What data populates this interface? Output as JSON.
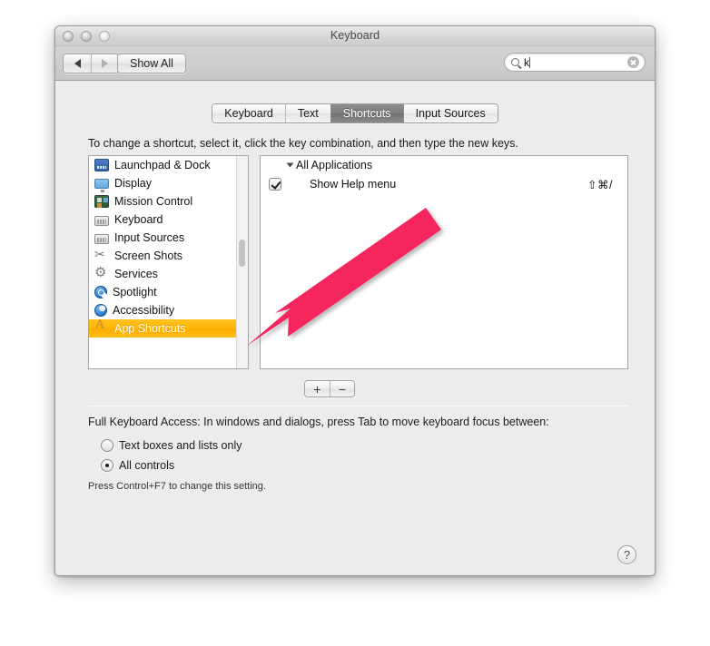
{
  "window": {
    "title": "Keyboard",
    "traffic_lights": [
      "close",
      "minimize",
      "zoom"
    ]
  },
  "toolbar": {
    "back_label": "Back",
    "forward_label": "Forward",
    "show_all_label": "Show All",
    "search": {
      "value": "k",
      "placeholder": "Search",
      "icon": "search-icon",
      "clear_icon": "clear-icon"
    }
  },
  "tabs": [
    {
      "label": "Keyboard",
      "selected": false
    },
    {
      "label": "Text",
      "selected": false
    },
    {
      "label": "Shortcuts",
      "selected": true
    },
    {
      "label": "Input Sources",
      "selected": false
    }
  ],
  "instruction": "To change a shortcut, select it, click the key combination, and then type the new keys.",
  "categories": [
    {
      "label": "Launchpad & Dock",
      "icon": "launchpad-dock-icon",
      "selected": false
    },
    {
      "label": "Display",
      "icon": "display-icon",
      "selected": false
    },
    {
      "label": "Mission Control",
      "icon": "mission-control-icon",
      "selected": false
    },
    {
      "label": "Keyboard",
      "icon": "keyboard-icon",
      "selected": false
    },
    {
      "label": "Input Sources",
      "icon": "input-sources-icon",
      "selected": false
    },
    {
      "label": "Screen Shots",
      "icon": "screen-shots-icon",
      "selected": false
    },
    {
      "label": "Services",
      "icon": "services-gear-icon",
      "selected": false
    },
    {
      "label": "Spotlight",
      "icon": "spotlight-icon",
      "selected": false
    },
    {
      "label": "Accessibility",
      "icon": "accessibility-icon",
      "selected": false
    },
    {
      "label": "App Shortcuts",
      "icon": "app-shortcuts-icon",
      "selected": true
    }
  ],
  "shortcuts": {
    "group_label": "All Applications",
    "items": [
      {
        "label": "Show Help menu",
        "keys": "⇧⌘/",
        "checked": true
      }
    ]
  },
  "list_buttons": {
    "add_label": "+",
    "remove_label": "−"
  },
  "full_keyboard_access": {
    "label": "Full Keyboard Access: In windows and dialogs, press Tab to move keyboard focus between:",
    "options": [
      {
        "label": "Text boxes and lists only",
        "selected": false
      },
      {
        "label": "All controls",
        "selected": true
      }
    ],
    "hint": "Press Control+F7 to change this setting."
  },
  "help_button": {
    "label": "?"
  },
  "annotation": {
    "type": "arrow",
    "color": "#F4275D",
    "points_to": "App Shortcuts"
  },
  "colors": {
    "selection": "#FFB60A",
    "tab_selected_bg": "#7C7C7C",
    "window_bg": "#ECECEC",
    "arrow": "#F4275D"
  }
}
